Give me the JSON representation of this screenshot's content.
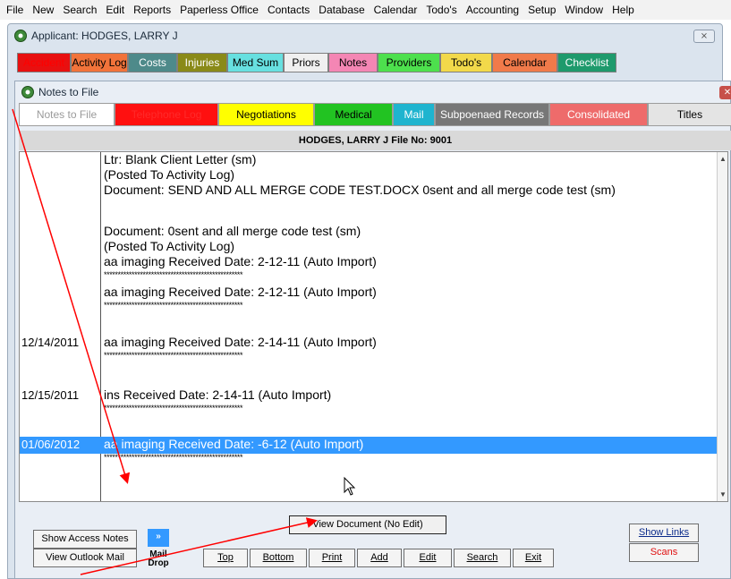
{
  "menu": [
    "File",
    "New",
    "Search",
    "Edit",
    "Reports",
    "Paperless Office",
    "Contacts",
    "Database",
    "Calendar",
    "Todo's",
    "Accounting",
    "Setup",
    "Window",
    "Help"
  ],
  "applicant_window": {
    "title": "Applicant: HODGES, LARRY J",
    "close_label": "⨯",
    "tabs": [
      {
        "label": "Accident",
        "bg": "#e81010",
        "fg": "#ff0000"
      },
      {
        "label": "Activity Log",
        "bg": "#f2733a",
        "fg": "#000000"
      },
      {
        "label": "Costs",
        "bg": "#4e8a8a",
        "fg": "#ffffff"
      },
      {
        "label": "Injuries",
        "bg": "#8a8a18",
        "fg": "#ffffff"
      },
      {
        "label": "Med Sum",
        "bg": "#67e0e0",
        "fg": "#000000"
      },
      {
        "label": "Priors",
        "bg": "#f0f0f0",
        "fg": "#000000"
      },
      {
        "label": "Notes",
        "bg": "#f486b4",
        "fg": "#000000"
      },
      {
        "label": "Providers",
        "bg": "#4de04d",
        "fg": "#000000"
      },
      {
        "label": "Todo's",
        "bg": "#f2d94a",
        "fg": "#000000"
      },
      {
        "label": "Calendar",
        "bg": "#f07a4a",
        "fg": "#000000"
      },
      {
        "label": "Checklist",
        "bg": "#1e9a6c",
        "fg": "#ffffff"
      }
    ]
  },
  "notes_window": {
    "title": "Notes to File",
    "close_label": "✕",
    "tabs": [
      {
        "label": "Notes to File",
        "bg": "#ffffff",
        "fg": "#9a9a9a"
      },
      {
        "label": "Telephone Log",
        "bg": "#ff1010",
        "fg": "#ff2a2a"
      },
      {
        "label": "Negotiations",
        "bg": "#ffff00",
        "fg": "#000000"
      },
      {
        "label": "Medical",
        "bg": "#22c322",
        "fg": "#000000"
      },
      {
        "label": "Mail",
        "bg": "#1fb4cf",
        "fg": "#ffffff"
      },
      {
        "label": "Subpoenaed Records",
        "bg": "#777777",
        "fg": "#ffffff"
      },
      {
        "label": "Consolidated",
        "bg": "#ee6b6b",
        "fg": "#ffffff"
      },
      {
        "label": "Titles",
        "bg": "#e4e4e4",
        "fg": "#000000"
      }
    ],
    "header": "HODGES, LARRY J     File No: 9001",
    "stars": "**************************************************",
    "entries": [
      {
        "date": "",
        "lines": [
          "Ltr: Blank Client Letter (sm)",
          "(Posted To Activity Log)",
          "Document: SEND AND ALL MERGE CODE TEST.DOCX 0sent and all merge code test (sm)"
        ]
      },
      {
        "date": "",
        "lines": [
          "Document: 0sent and all merge code test (sm)",
          "(Posted To Activity Log)",
          "aa imaging Received Date: 2-12-11 (Auto Import)"
        ]
      },
      {
        "date": "",
        "lines": [
          "aa imaging Received Date: 2-12-11 (Auto Import)"
        ]
      },
      {
        "date": "12/14/2011",
        "lines": [
          "aa imaging Received Date: 2-14-11 (Auto Import)"
        ]
      },
      {
        "date": "12/15/2011",
        "lines": [
          "ins Received Date: 2-14-11 (Auto Import)"
        ]
      },
      {
        "date": "01/06/2012",
        "lines": [
          "aa imaging Received Date: -6-12 (Auto Import)"
        ],
        "selected": true
      }
    ]
  },
  "buttons": {
    "show_access_notes": "Show Access Notes",
    "view_outlook_mail": "View Outlook Mail",
    "mail_drop_arrow": "»",
    "mail_drop": "Mail Drop",
    "view_document": "View Document (No Edit)",
    "top": "Top",
    "bottom": "Bottom",
    "print": "Print",
    "add": "Add",
    "edit": "Edit",
    "search": "Search",
    "exit": "Exit",
    "show_links": "Show Links",
    "scans": "Scans"
  },
  "colors": {
    "selection": "#3399ff",
    "annotation_arrow": "#ff0000"
  }
}
